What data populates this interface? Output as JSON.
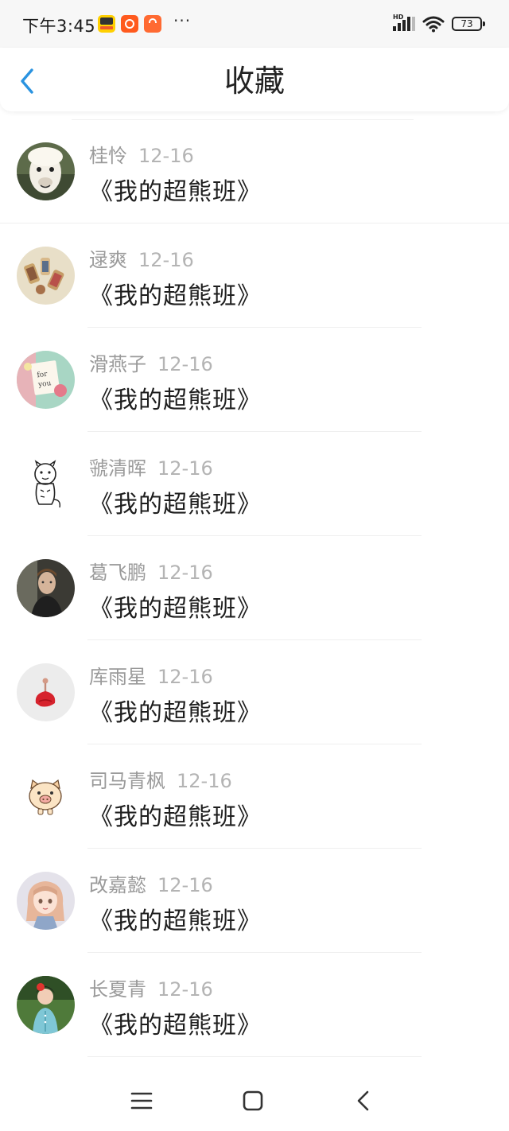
{
  "status_bar": {
    "time": "下午3:45",
    "more": "···",
    "signal_label": "HD",
    "battery": "73",
    "apps": [
      "meituan-app-icon",
      "kuaishou-app-icon",
      "shopping-bag-app-icon"
    ]
  },
  "header": {
    "title": "收藏",
    "back_icon": "chevron-left-icon",
    "accent_color": "#2a93e0"
  },
  "favorites": [
    {
      "name": "桂怜",
      "date": "12-16",
      "book": "《我的超熊班》",
      "avatar": "alpaca-avatar"
    },
    {
      "name": "逯爽",
      "date": "12-16",
      "book": "《我的超熊班》",
      "avatar": "thread-spools-avatar"
    },
    {
      "name": "滑燕子",
      "date": "12-16",
      "book": "《我的超熊班》",
      "avatar": "for-you-card-avatar"
    },
    {
      "name": "虢清晖",
      "date": "12-16",
      "book": "《我的超熊班》",
      "avatar": "cartoon-tiger-avatar"
    },
    {
      "name": "葛飞鹏",
      "date": "12-16",
      "book": "《我的超熊班》",
      "avatar": "man-portrait-avatar"
    },
    {
      "name": "库雨星",
      "date": "12-16",
      "book": "《我的超熊班》",
      "avatar": "red-dress-figure-avatar"
    },
    {
      "name": "司马青枫",
      "date": "12-16",
      "book": "《我的超熊班》",
      "avatar": "cartoon-pig-avatar"
    },
    {
      "name": "改嘉懿",
      "date": "12-16",
      "book": "《我的超熊班》",
      "avatar": "anime-girl-avatar"
    },
    {
      "name": "长夏青",
      "date": "12-16",
      "book": "《我的超熊班》",
      "avatar": "child-photo-avatar"
    }
  ],
  "nav_bar": {
    "menu_icon": "menu-icon",
    "home_icon": "home-square-icon",
    "back_icon": "back-chevron-icon"
  }
}
